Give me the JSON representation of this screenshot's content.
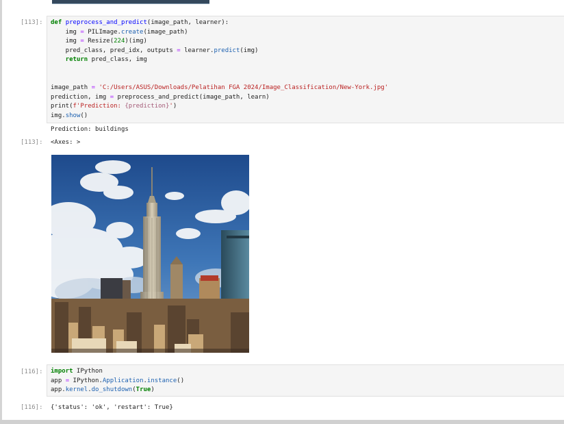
{
  "cells": {
    "cell113": {
      "prompt_in": "[113]:",
      "prompt_out": "[113]:",
      "code": {
        "l1_def": "def",
        "l1_name": "preprocess_and_predict",
        "l1_rest": "(image_path, learner):",
        "l2_a": "    img ",
        "l2_eq": "=",
        "l2_b": " PILImage.",
        "l2_c": "create",
        "l2_d": "(image_path)",
        "l3_a": "    img ",
        "l3_eq": "=",
        "l3_b": " Resize(",
        "l3_num": "224",
        "l3_c": ")(img)",
        "l4_a": "    pred_class, pred_idx, outputs ",
        "l4_eq": "=",
        "l4_b": " learner.",
        "l4_c": "predict",
        "l4_d": "(img)",
        "l5_ret": "    return",
        "l5_b": " pred_class, img",
        "l6_a": "image_path ",
        "l6_eq": "=",
        "l6_str": " 'C:/Users/ASUS/Downloads/Pelatihan FGA 2024/Image_Classification/New-York.jpg'",
        "l7_a": "prediction, img ",
        "l7_eq": "=",
        "l7_b": " preprocess_and_predict(image_path, learn)",
        "l8_a": "print(",
        "l8_f": "f'Prediction: ",
        "l8_i": "{prediction}",
        "l8_q": "'",
        "l8_e": ")",
        "l9_a": "img.",
        "l9_b": "show",
        "l9_c": "()"
      },
      "stdout": "Prediction: buildings",
      "result": "<Axes: >"
    },
    "cell116": {
      "prompt_in": "[116]:",
      "prompt_out": "[116]:",
      "code": {
        "l1_kw": "import",
        "l1_b": " IPython",
        "l2_a": "app ",
        "l2_eq": "=",
        "l2_b": " IPython.",
        "l2_c": "Application",
        "l2_d": ".",
        "l2_e": "instance",
        "l2_f": "()",
        "l3_a": "app.",
        "l3_b": "kernel",
        "l3_c": ".",
        "l3_d": "do_shutdown",
        "l3_e": "(",
        "l3_true": "True",
        "l3_f": ")"
      },
      "result": "{'status': 'ok', 'restart': True}"
    }
  },
  "colors": {
    "keyword": "#008000",
    "function": "#0000ff",
    "string": "#ba2121",
    "attribute": "#1c60b0",
    "prompt": "#8c8c8c"
  }
}
